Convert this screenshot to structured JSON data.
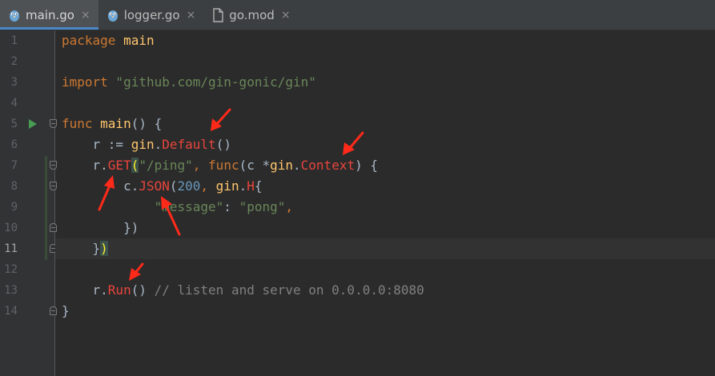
{
  "tabs": [
    {
      "label": "main.go",
      "icon": "gopher-icon",
      "active": true,
      "close": "×"
    },
    {
      "label": "logger.go",
      "icon": "gopher-icon",
      "active": false,
      "close": "×"
    },
    {
      "label": "go.mod",
      "icon": "file-icon",
      "active": false,
      "close": "×"
    }
  ],
  "line_numbers": [
    "1",
    "2",
    "3",
    "4",
    "5",
    "6",
    "7",
    "8",
    "9",
    "10",
    "11",
    "12",
    "13",
    "14"
  ],
  "current_line": "11",
  "code": {
    "l1_kw": "package",
    "l1_name": " main",
    "l3_kw": "import",
    "l3_str": " \"github.com/gin-gonic/gin\"",
    "l5_kw": "func",
    "l5_name": " main",
    "l5_rest": "() {",
    "l6_pre": "    r := ",
    "l6_pkg": "gin",
    "l6_dot": ".",
    "l6_fn": "Default",
    "l6_rest": "()",
    "l7_pre": "    r.",
    "l7_fn": "GET",
    "l7_paren": "(",
    "l7_str": "\"/ping\"",
    "l7_comma": ", ",
    "l7_kw": "func",
    "l7_args": "(c *",
    "l7_pkg": "gin",
    "l7_dot": ".",
    "l7_type": "Context",
    "l7_rest": ") {",
    "l8_pre": "        c.",
    "l8_fn": "JSON",
    "l8_paren": "(",
    "l8_num": "200",
    "l8_comma": ", ",
    "l8_pkg": "gin",
    "l8_dot": ".",
    "l8_type": "H",
    "l8_rest": "{",
    "l9_pre": "            ",
    "l9_key": "\"message\"",
    "l9_colon": ": ",
    "l9_val": "\"pong\"",
    "l9_rest": ",",
    "l10_text": "        })",
    "l11_pre": "    ",
    "l11_brace": "}",
    "l11_paren": ")",
    "l13_pre": "    r.",
    "l13_fn": "Run",
    "l13_rest": "() ",
    "l13_cmt": "// listen and serve on 0.0.0.0:8080",
    "l14_text": "}"
  },
  "colors": {
    "keyword": "#cc7832",
    "string": "#6a8759",
    "number": "#6897bb",
    "comment": "#808080",
    "highlight_red": "#e8453c",
    "annotation_arrow": "#ff2a1a"
  }
}
